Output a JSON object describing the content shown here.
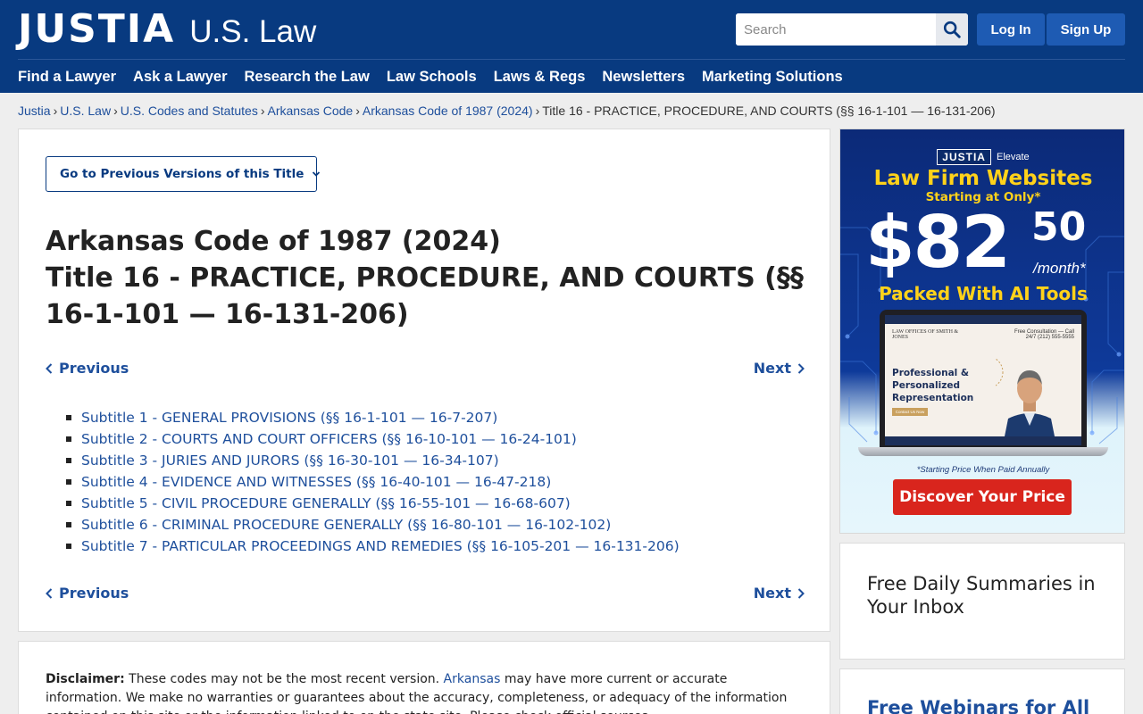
{
  "header": {
    "logo_brand": "JUSTIA",
    "logo_sub": "U.S. Law",
    "search_placeholder": "Search",
    "login_label": "Log In",
    "signup_label": "Sign Up",
    "nav": [
      "Find a Lawyer",
      "Ask a Lawyer",
      "Research the Law",
      "Law Schools",
      "Laws & Regs",
      "Newsletters",
      "Marketing Solutions"
    ],
    "brand_color": "#083a80"
  },
  "breadcrumb": {
    "links": [
      "Justia",
      "U.S. Law",
      "U.S. Codes and Statutes",
      "Arkansas Code",
      "Arkansas Code of 1987 (2024)"
    ],
    "separator": "›",
    "current": "Title 16 - PRACTICE, PROCEDURE, AND COURTS (§§ 16-1-101 — 16-131-206)"
  },
  "main": {
    "versions_button": "Go to Previous Versions of this Title",
    "title_line1": "Arkansas Code of 1987 (2024)",
    "title_line2": "Title 16 - PRACTICE, PROCEDURE, AND COURTS (§§ 16-1-101 — 16-131-206)",
    "previous_label": "Previous",
    "next_label": "Next",
    "subtitles": [
      "Subtitle 1 - GENERAL PROVISIONS (§§ 16-1-101 — 16-7-207)",
      "Subtitle 2 - COURTS AND COURT OFFICERS (§§ 16-10-101 — 16-24-101)",
      "Subtitle 3 - JURIES AND JURORS (§§ 16-30-101 — 16-34-107)",
      "Subtitle 4 - EVIDENCE AND WITNESSES (§§ 16-40-101 — 16-47-218)",
      "Subtitle 5 - CIVIL PROCEDURE GENERALLY (§§ 16-55-101 — 16-68-607)",
      "Subtitle 6 - CRIMINAL PROCEDURE GENERALLY (§§ 16-80-101 — 16-102-102)",
      "Subtitle 7 - PARTICULAR PROCEEDINGS AND REMEDIES (§§ 16-105-201 — 16-131-206)"
    ]
  },
  "disclaimer": {
    "label": "Disclaimer:",
    "text_before": " These codes may not be the most recent version. ",
    "link": "Arkansas",
    "text_after": " may have more current or accurate information. We make no warranties or guarantees about the accuracy, completeness, or adequacy of the information contained on this site or the information linked to on the state site. Please check official sources."
  },
  "ad": {
    "brand_tag": "JUSTIA",
    "brand_suffix": "Elevate",
    "headline": "Law Firm Websites",
    "subheadline": "Starting at Only*",
    "price_dollars": "$82",
    "price_cents": "50",
    "per": "/month*",
    "tagline": "Packed With AI Tools",
    "screen_firm": "LAW OFFICES OF SMITH & JONES",
    "screen_phone": "Free Consultation — Call 24/7 (212) 555-5555",
    "screen_headline": "Professional & Personalized Representation",
    "screen_button": "Contact Us Now",
    "fine_print": "*Starting Price When Paid Annually",
    "cta": "Discover Your Price",
    "accent_color": "#ffd21a",
    "cta_color": "#d9251d"
  },
  "sidebar": {
    "newsletter_title": "Free Daily Summaries in Your Inbox",
    "webinars_title": "Free Webinars for All"
  }
}
